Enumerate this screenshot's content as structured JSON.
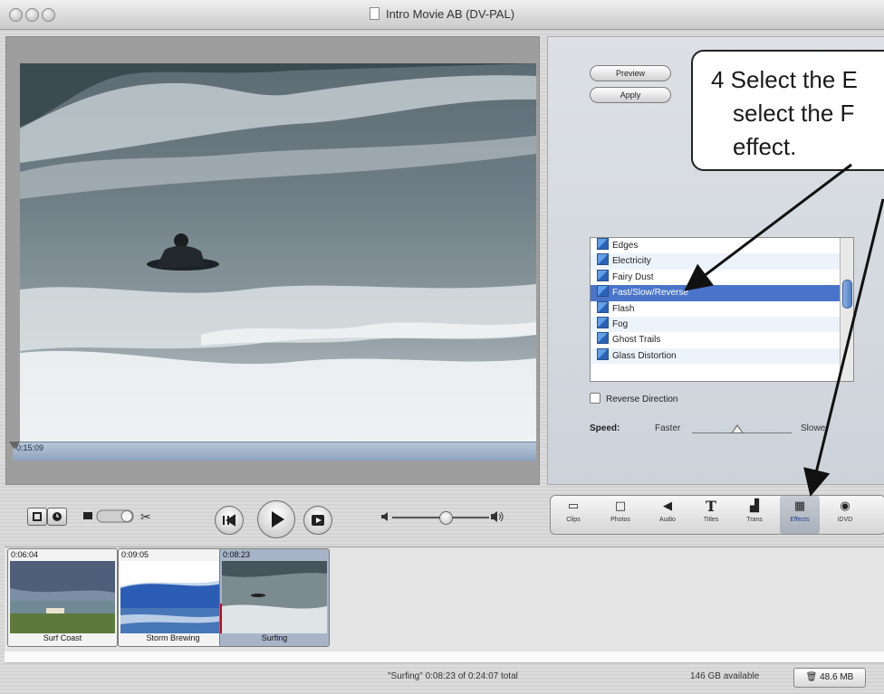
{
  "window": {
    "title": "Intro Movie AB (DV-PAL)"
  },
  "viewer": {
    "timecode": "0:15:09"
  },
  "effects_panel": {
    "preview_label": "Preview",
    "apply_label": "Apply",
    "effects": [
      {
        "label": "Edges",
        "selected": false
      },
      {
        "label": "Electricity",
        "selected": false
      },
      {
        "label": "Fairy Dust",
        "selected": false
      },
      {
        "label": "Fast/Slow/Reverse",
        "selected": true
      },
      {
        "label": "Flash",
        "selected": false
      },
      {
        "label": "Fog",
        "selected": false
      },
      {
        "label": "Ghost Trails",
        "selected": false
      },
      {
        "label": "Glass Distortion",
        "selected": false
      }
    ],
    "reverse_direction_label": "Reverse Direction",
    "reverse_direction_checked": false,
    "speed_label": "Speed:",
    "speed_faster_label": "Faster",
    "speed_slower_label": "Slower",
    "speed_value": 0.45
  },
  "toolbar": {
    "tools": [
      {
        "label": "Clips",
        "icon": "clips-icon"
      },
      {
        "label": "Photos",
        "icon": "photos-icon"
      },
      {
        "label": "Audio",
        "icon": "audio-icon"
      },
      {
        "label": "Titles",
        "icon": "titles-icon"
      },
      {
        "label": "Trans",
        "icon": "transitions-icon"
      },
      {
        "label": "Effects",
        "icon": "effects-icon",
        "active": true
      },
      {
        "label": "iDVD",
        "icon": "idvd-icon"
      }
    ]
  },
  "clips": [
    {
      "time": "0:06:04",
      "name": "Surf Coast",
      "selected": false
    },
    {
      "time": "0:09:05",
      "name": "Storm Brewing",
      "selected": false
    },
    {
      "time": "0:08:23",
      "name": "Surfing",
      "selected": true
    }
  ],
  "status": {
    "clip_info": "\"Surfing\"  0:08:23 of 0:24:07 total",
    "available": "146 GB available",
    "trash_size": "48.6 MB"
  },
  "callout": {
    "line1": "4  Select the E",
    "line2": "select the F",
    "line3": "effect."
  },
  "colors": {
    "selection": "#4a74c9",
    "accent_blue": "#2a63b8"
  }
}
